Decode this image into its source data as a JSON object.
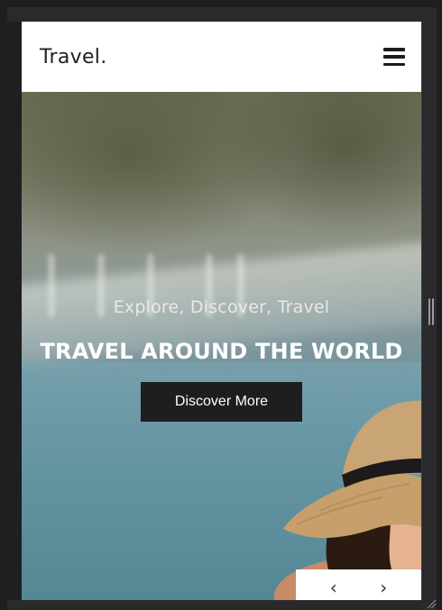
{
  "header": {
    "brand": "Travel.",
    "menu_icon": "hamburger-icon"
  },
  "hero": {
    "tagline": "Explore, Discover, Travel",
    "headline": "TRAVEL AROUND THE WORLD",
    "cta_label": "Discover More"
  },
  "slider": {
    "prev_icon": "chevron-left-icon",
    "next_icon": "chevron-right-icon",
    "prev_glyph": "‹",
    "next_glyph": "›"
  },
  "colors": {
    "header_bg": "#ffffff",
    "cta_bg": "#1e1e1e",
    "frame_bg": "#1f1f22"
  }
}
